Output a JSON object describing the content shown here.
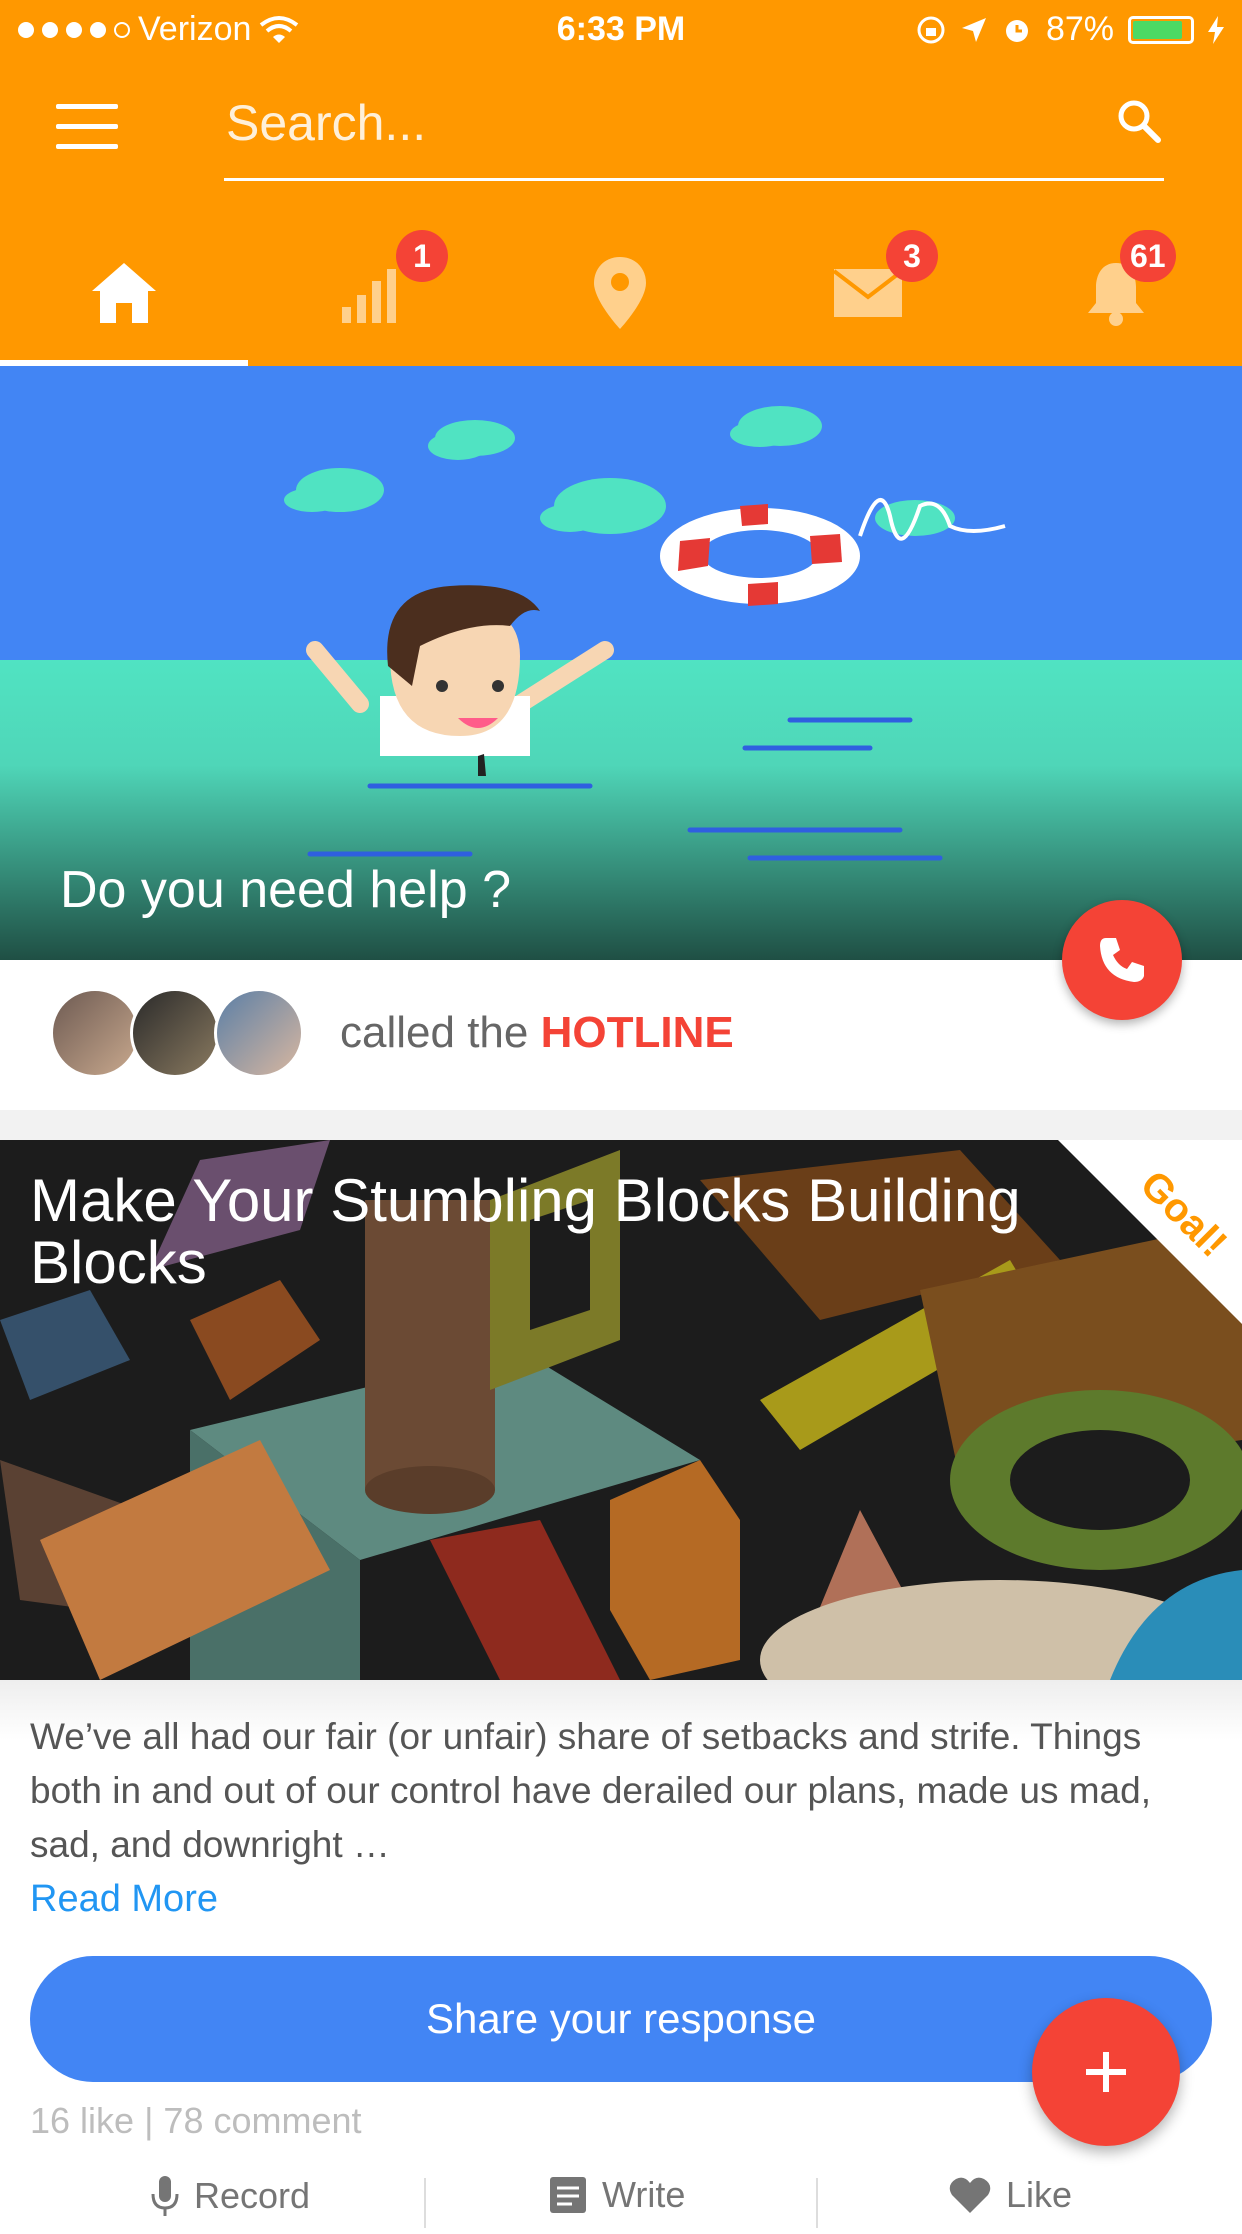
{
  "status_bar": {
    "carrier": "Verizon",
    "time": "6:33 PM",
    "battery": "87%",
    "battery_level": 0.87
  },
  "header": {
    "search_placeholder": "Search...",
    "tabs": [
      {
        "name": "home",
        "icon": "home-icon",
        "badge": ""
      },
      {
        "name": "stats",
        "icon": "bar-chart-icon",
        "badge": "1"
      },
      {
        "name": "location",
        "icon": "map-pin-icon",
        "badge": ""
      },
      {
        "name": "messages",
        "icon": "mail-icon",
        "badge": "3"
      },
      {
        "name": "notifications",
        "icon": "bell-icon",
        "badge": "61"
      }
    ],
    "active_tab": "home"
  },
  "hero": {
    "title": "Do you need help ?",
    "call_icon": "phone-icon"
  },
  "hotline": {
    "prefix": "called the",
    "highlight": "HOTLINE"
  },
  "article": {
    "title": "Make Your Stumbling Blocks Building Blocks",
    "ribbon": "Goal!",
    "excerpt": "We’ve all had our fair (or unfair) share of setbacks and strife. Things both in and out of our control have derailed our plans, made us mad, sad, and downright …",
    "read_more": "Read More",
    "share_label": "Share your response",
    "stats": "16 like | 78 comment",
    "actions": [
      "Record",
      "Write",
      "Like"
    ]
  },
  "colors": {
    "primary": "#ff9800",
    "accent": "#f44336",
    "blue": "#4285f4",
    "link": "#2196f3"
  }
}
